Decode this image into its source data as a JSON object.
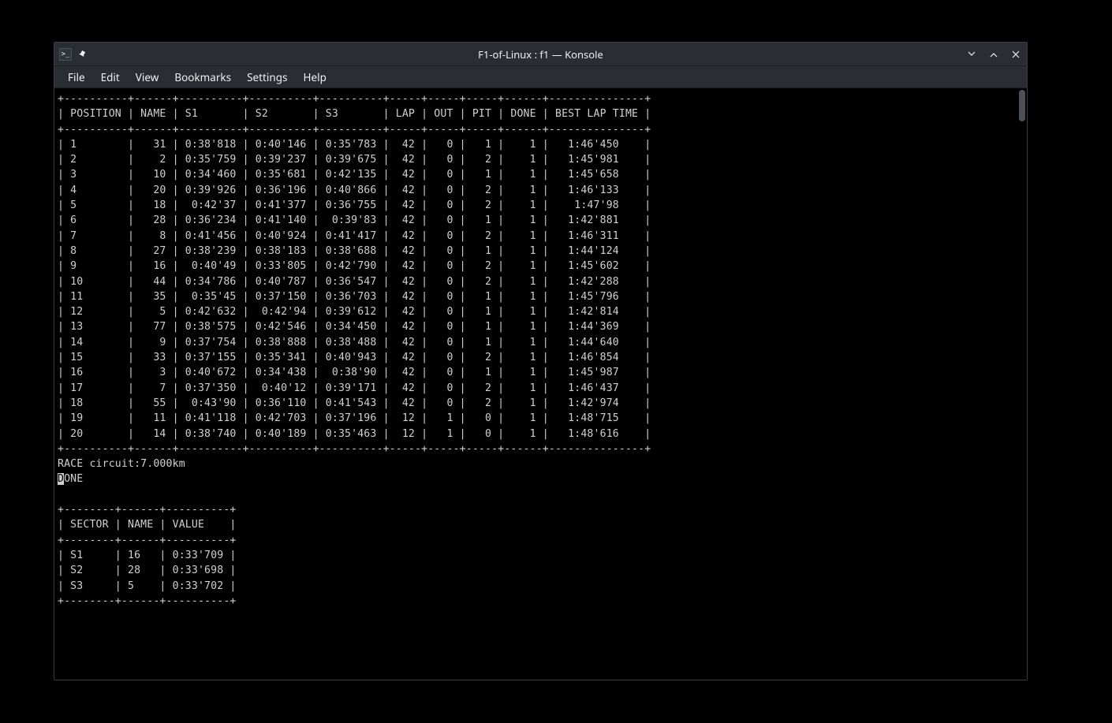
{
  "window": {
    "title": "F1-of-Linux : f1 — Konsole",
    "app_icon_text": ">_"
  },
  "menubar": {
    "items": [
      "File",
      "Edit",
      "View",
      "Bookmarks",
      "Settings",
      "Help"
    ]
  },
  "terminal": {
    "headers": [
      "POSITION",
      "NAME",
      "S1",
      "S2",
      "S3",
      "LAP",
      "OUT",
      "PIT",
      "DONE",
      "BEST LAP TIME"
    ],
    "rows": [
      {
        "pos": "1",
        "name": "31",
        "s1": "0:38'818",
        "s2": "0:40'146",
        "s3": "0:35'783",
        "lap": "42",
        "out": "0",
        "pit": "1",
        "done": "1",
        "best": "1:46'450"
      },
      {
        "pos": "2",
        "name": "2",
        "s1": "0:35'759",
        "s2": "0:39'237",
        "s3": "0:39'675",
        "lap": "42",
        "out": "0",
        "pit": "2",
        "done": "1",
        "best": "1:45'981"
      },
      {
        "pos": "3",
        "name": "10",
        "s1": "0:34'460",
        "s2": "0:35'681",
        "s3": "0:42'135",
        "lap": "42",
        "out": "0",
        "pit": "1",
        "done": "1",
        "best": "1:45'658"
      },
      {
        "pos": "4",
        "name": "20",
        "s1": "0:39'926",
        "s2": "0:36'196",
        "s3": "0:40'866",
        "lap": "42",
        "out": "0",
        "pit": "2",
        "done": "1",
        "best": "1:46'133"
      },
      {
        "pos": "5",
        "name": "18",
        "s1": "0:42'37",
        "s2": "0:41'377",
        "s3": "0:36'755",
        "lap": "42",
        "out": "0",
        "pit": "2",
        "done": "1",
        "best": "1:47'98"
      },
      {
        "pos": "6",
        "name": "28",
        "s1": "0:36'234",
        "s2": "0:41'140",
        "s3": "0:39'83",
        "lap": "42",
        "out": "0",
        "pit": "1",
        "done": "1",
        "best": "1:42'881"
      },
      {
        "pos": "7",
        "name": "8",
        "s1": "0:41'456",
        "s2": "0:40'924",
        "s3": "0:41'417",
        "lap": "42",
        "out": "0",
        "pit": "2",
        "done": "1",
        "best": "1:46'311"
      },
      {
        "pos": "8",
        "name": "27",
        "s1": "0:38'239",
        "s2": "0:38'183",
        "s3": "0:38'688",
        "lap": "42",
        "out": "0",
        "pit": "1",
        "done": "1",
        "best": "1:44'124"
      },
      {
        "pos": "9",
        "name": "16",
        "s1": "0:40'49",
        "s2": "0:33'805",
        "s3": "0:42'790",
        "lap": "42",
        "out": "0",
        "pit": "2",
        "done": "1",
        "best": "1:45'602"
      },
      {
        "pos": "10",
        "name": "44",
        "s1": "0:34'786",
        "s2": "0:40'787",
        "s3": "0:36'547",
        "lap": "42",
        "out": "0",
        "pit": "2",
        "done": "1",
        "best": "1:42'288"
      },
      {
        "pos": "11",
        "name": "35",
        "s1": "0:35'45",
        "s2": "0:37'150",
        "s3": "0:36'703",
        "lap": "42",
        "out": "0",
        "pit": "1",
        "done": "1",
        "best": "1:45'796"
      },
      {
        "pos": "12",
        "name": "5",
        "s1": "0:42'632",
        "s2": "0:42'94",
        "s3": "0:39'612",
        "lap": "42",
        "out": "0",
        "pit": "1",
        "done": "1",
        "best": "1:42'814"
      },
      {
        "pos": "13",
        "name": "77",
        "s1": "0:38'575",
        "s2": "0:42'546",
        "s3": "0:34'450",
        "lap": "42",
        "out": "0",
        "pit": "1",
        "done": "1",
        "best": "1:44'369"
      },
      {
        "pos": "14",
        "name": "9",
        "s1": "0:37'754",
        "s2": "0:38'888",
        "s3": "0:38'488",
        "lap": "42",
        "out": "0",
        "pit": "1",
        "done": "1",
        "best": "1:44'640"
      },
      {
        "pos": "15",
        "name": "33",
        "s1": "0:37'155",
        "s2": "0:35'341",
        "s3": "0:40'943",
        "lap": "42",
        "out": "0",
        "pit": "2",
        "done": "1",
        "best": "1:46'854"
      },
      {
        "pos": "16",
        "name": "3",
        "s1": "0:40'672",
        "s2": "0:34'438",
        "s3": "0:38'90",
        "lap": "42",
        "out": "0",
        "pit": "1",
        "done": "1",
        "best": "1:45'987"
      },
      {
        "pos": "17",
        "name": "7",
        "s1": "0:37'350",
        "s2": "0:40'12",
        "s3": "0:39'171",
        "lap": "42",
        "out": "0",
        "pit": "2",
        "done": "1",
        "best": "1:46'437"
      },
      {
        "pos": "18",
        "name": "55",
        "s1": "0:43'90",
        "s2": "0:36'110",
        "s3": "0:41'543",
        "lap": "42",
        "out": "0",
        "pit": "2",
        "done": "1",
        "best": "1:42'974"
      },
      {
        "pos": "19",
        "name": "11",
        "s1": "0:41'118",
        "s2": "0:42'703",
        "s3": "0:37'196",
        "lap": "12",
        "out": "1",
        "pit": "0",
        "done": "1",
        "best": "1:48'715"
      },
      {
        "pos": "20",
        "name": "14",
        "s1": "0:38'740",
        "s2": "0:40'189",
        "s3": "0:35'463",
        "lap": "12",
        "out": "1",
        "pit": "0",
        "done": "1",
        "best": "1:48'616"
      }
    ],
    "status_line": "RACE circuit:7.000km",
    "done_line": "DONE",
    "sector_headers": [
      "SECTOR",
      "NAME",
      "VALUE"
    ],
    "sector_rows": [
      {
        "sector": "S1",
        "name": "16",
        "value": "0:33'709"
      },
      {
        "sector": "S2",
        "name": "28",
        "value": "0:33'698"
      },
      {
        "sector": "S3",
        "name": "5",
        "value": "0:33'702"
      }
    ]
  }
}
